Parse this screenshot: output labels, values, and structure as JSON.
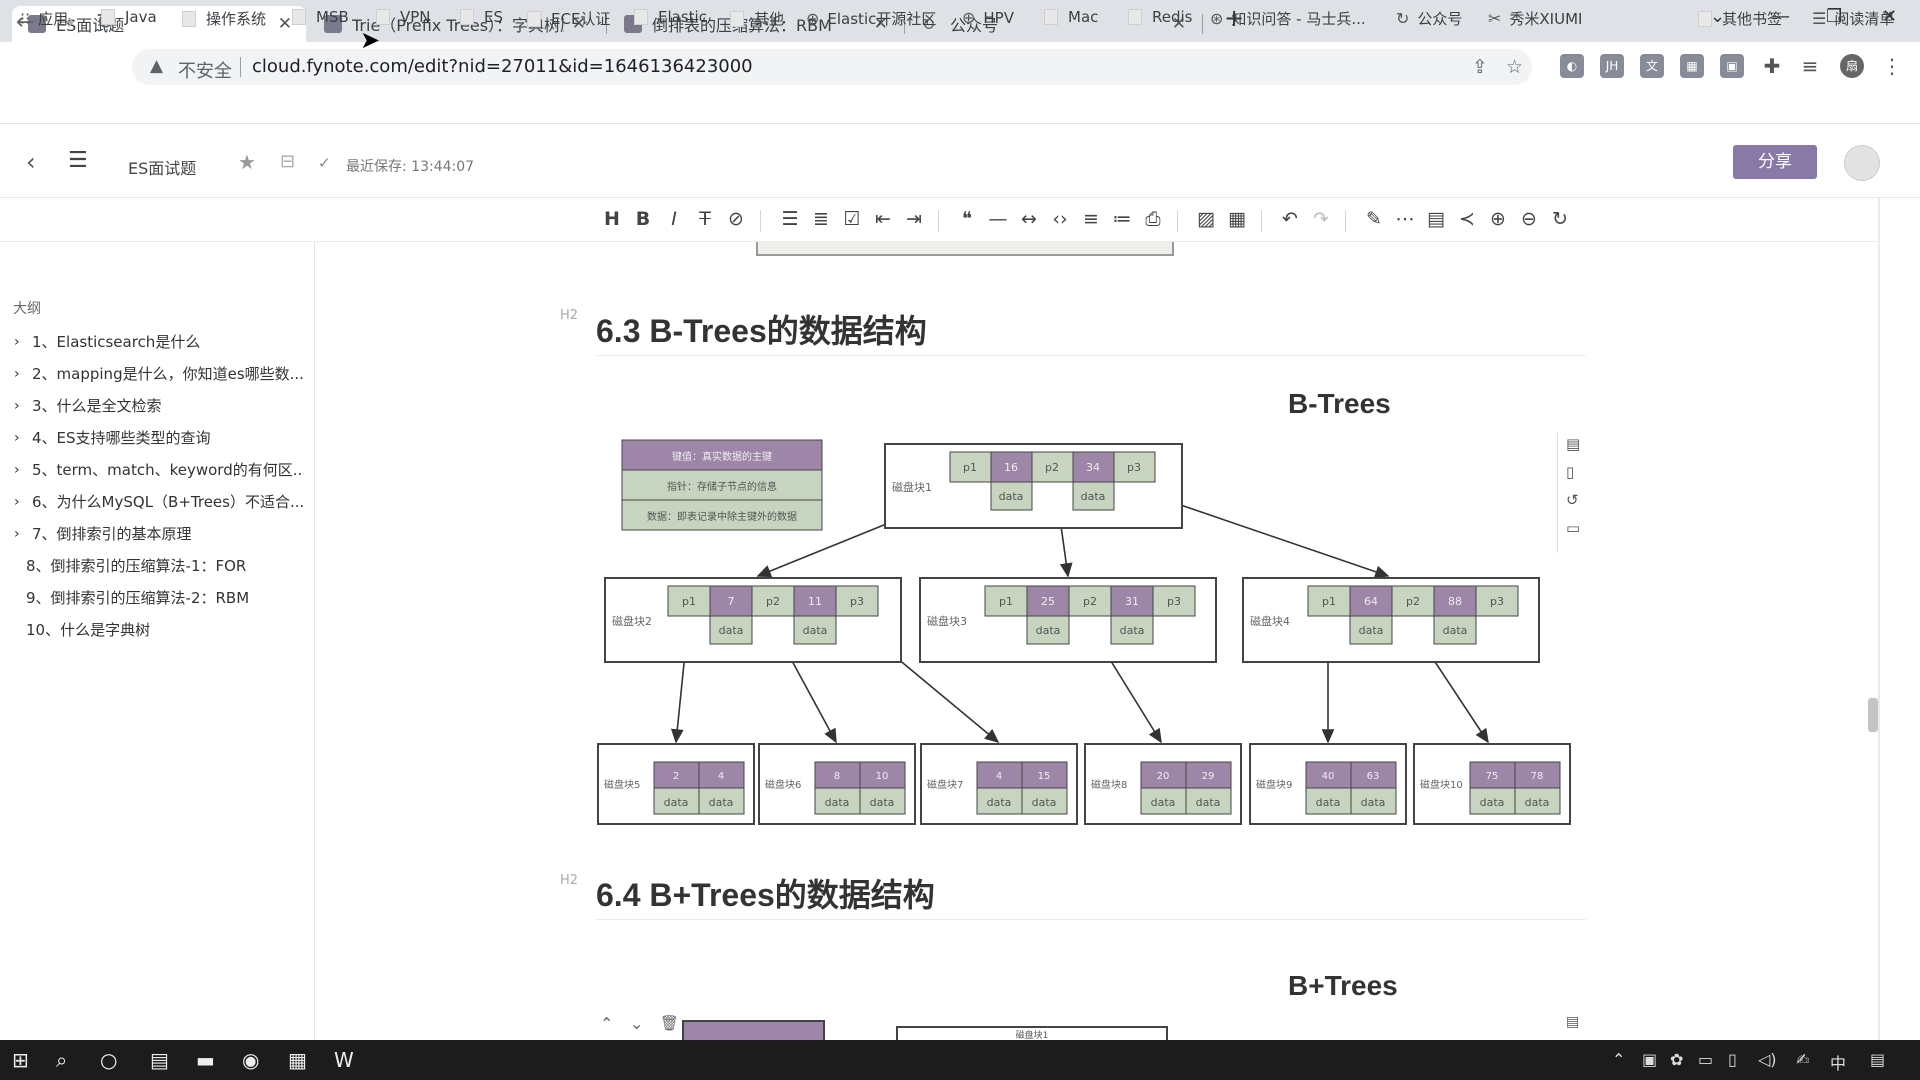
{
  "browser": {
    "tabs": [
      {
        "title": "ES面试题",
        "close": "✕"
      },
      {
        "title": "Trie（Prefix Trees）：字典树原",
        "close": "✕"
      },
      {
        "title": "倒排表的压缩算法：RBM",
        "close": "✕"
      },
      {
        "title": "公众号",
        "close": "✕"
      }
    ],
    "new_tab": "+",
    "security_label": "不安全",
    "url": "cloud.fynote.com/edit?nid=27011&id=1646136423000",
    "bookmarks": [
      "应用",
      "Java",
      "操作系统",
      "MSB",
      "VPN",
      "ES",
      "ECE认证",
      "Elastic",
      "其他",
      "Elastic开源社区",
      "HPV",
      "Mac",
      "Redis",
      "知识问答 - 马士兵...",
      "公众号",
      "秀米XIUMI"
    ],
    "other_bookmarks": "其他书签",
    "reading_list": "阅读清单",
    "profile_initial": "扇"
  },
  "app": {
    "doc_title": "ES面试题",
    "last_saved": "最近保存: 13:44:07",
    "share_label": "分享"
  },
  "outline": {
    "title": "大纲",
    "items": [
      "1、Elasticsearch是什么",
      "2、mapping是什么，你知道es哪些数...",
      "3、什么是全文检索",
      "4、ES支持哪些类型的查询",
      "5、term、match、keyword的有何区...",
      "6、为什么MySQL（B+Trees）不适合...",
      "7、倒排索引的基本原理",
      "8、倒排索引的压缩算法-1：FOR",
      "9、倒排索引的压缩算法-2：RBM",
      "10、什么是字典树"
    ]
  },
  "content": {
    "h2_tag": "H2",
    "section1": "6.3 B-Trees的数据结构",
    "fig1_title": "B-Trees",
    "section2": "6.4 B+Trees的数据结构",
    "fig2_title": "B+Trees",
    "legend": [
      "键值：真实数据的主键",
      "指针：存储子节点的信息",
      "数据：即表记录中除主键外的数据"
    ],
    "root": {
      "label": "磁盘块1",
      "cells": [
        "p1",
        "16",
        "p2",
        "34",
        "p3"
      ],
      "data": [
        "data",
        "data"
      ]
    },
    "mid": [
      {
        "label": "磁盘块2",
        "cells": [
          "p1",
          "7",
          "p2",
          "11",
          "p3"
        ],
        "data": [
          "data",
          "data"
        ]
      },
      {
        "label": "磁盘块3",
        "cells": [
          "p1",
          "25",
          "p2",
          "31",
          "p3"
        ],
        "data": [
          "data",
          "data"
        ]
      },
      {
        "label": "磁盘块4",
        "cells": [
          "p1",
          "64",
          "p2",
          "88",
          "p3"
        ],
        "data": [
          "data",
          "data"
        ]
      }
    ],
    "leaves": [
      {
        "label": "磁盘块5",
        "keys": [
          "2",
          "4"
        ]
      },
      {
        "label": "磁盘块6",
        "keys": [
          "8",
          "10"
        ]
      },
      {
        "label": "磁盘块7",
        "keys": [
          "4",
          "15"
        ]
      },
      {
        "label": "磁盘块8",
        "keys": [
          "20",
          "29"
        ]
      },
      {
        "label": "磁盘块9",
        "keys": [
          "40",
          "63"
        ]
      },
      {
        "label": "磁盘块10",
        "keys": [
          "75",
          "78"
        ]
      }
    ],
    "leaf_data": "data",
    "fig2_root_label": "磁盘块1"
  },
  "taskbar": {
    "ime": "中"
  },
  "colors": {
    "key_fill": "#9e86a8",
    "ptr_fill": "#c7d4bf",
    "data_fill": "#c7d4bf",
    "share": "#8979a6"
  }
}
